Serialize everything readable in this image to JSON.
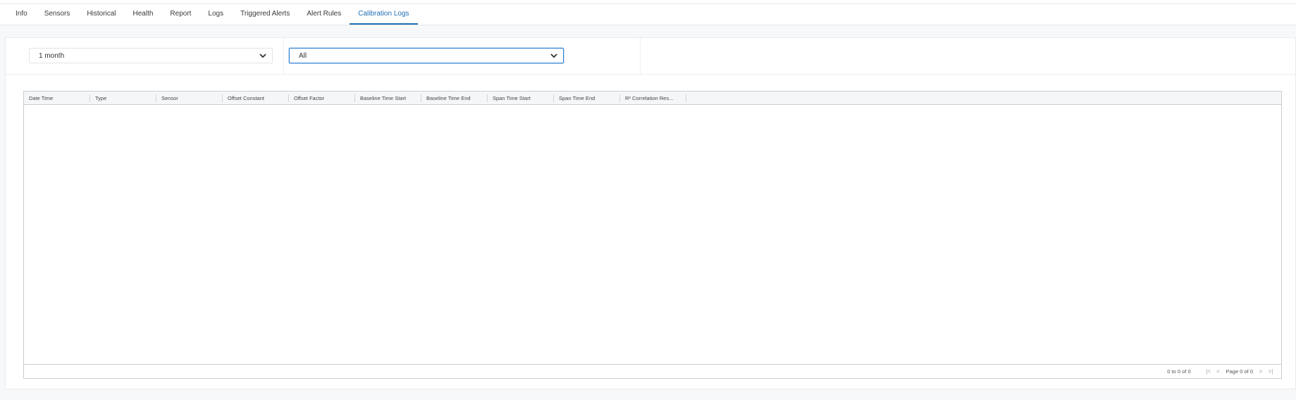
{
  "tabs": [
    {
      "label": "Info",
      "active": false
    },
    {
      "label": "Sensors",
      "active": false
    },
    {
      "label": "Historical",
      "active": false
    },
    {
      "label": "Health",
      "active": false
    },
    {
      "label": "Report",
      "active": false
    },
    {
      "label": "Logs",
      "active": false
    },
    {
      "label": "Triggered Alerts",
      "active": false
    },
    {
      "label": "Alert Rules",
      "active": false
    },
    {
      "label": "Calibration Logs",
      "active": true
    }
  ],
  "filters": {
    "period": {
      "value": "1 month"
    },
    "sensor": {
      "value": "All"
    }
  },
  "table": {
    "columns": [
      "Date Time",
      "Type",
      "Sensor",
      "Offset Constant",
      "Offset Factor",
      "Baseline Time Start",
      "Baseline Time End",
      "Span Time Start",
      "Span Time End",
      "R² Correlation Res..."
    ],
    "rows": []
  },
  "pagination": {
    "summary": "0 to 0 of 0",
    "first": "|<",
    "prev": "<",
    "page_text": "Page 0 of 0",
    "next": ">",
    "last": ">|"
  },
  "colors": {
    "accent": "#1f6fb5",
    "focus_border": "#2c7fd1"
  },
  "icons": {
    "dropdown": "chevron-down-icon"
  }
}
